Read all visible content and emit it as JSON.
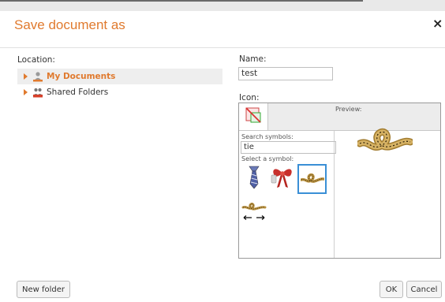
{
  "dialog": {
    "title": "Save document as",
    "close_glyph": "×"
  },
  "location": {
    "label": "Location:",
    "items": [
      {
        "label": "My Documents",
        "icon": "user-folder-icon",
        "selected": true
      },
      {
        "label": "Shared Folders",
        "icon": "shared-folder-icon",
        "selected": false
      }
    ]
  },
  "name": {
    "label": "Name:",
    "value": "test"
  },
  "icon": {
    "label": "Icon:",
    "toolbar_button_icon": "no-symbol-icon",
    "search_label": "Search symbols:",
    "search_value": "tie",
    "select_label": "Select a symbol:",
    "preview_label": "Preview:",
    "symbols": [
      {
        "name": "necktie-symbol",
        "selected": false
      },
      {
        "name": "ribbon-bow-symbol",
        "selected": false
      },
      {
        "name": "rope-knot-symbol",
        "selected": true
      },
      {
        "name": "untie-knot-symbol",
        "selected": false
      }
    ]
  },
  "buttons": {
    "new_folder": "New folder",
    "ok": "OK",
    "cancel": "Cancel"
  },
  "colors": {
    "accent": "#e07a2e",
    "selection_border": "#3a8fd6"
  }
}
